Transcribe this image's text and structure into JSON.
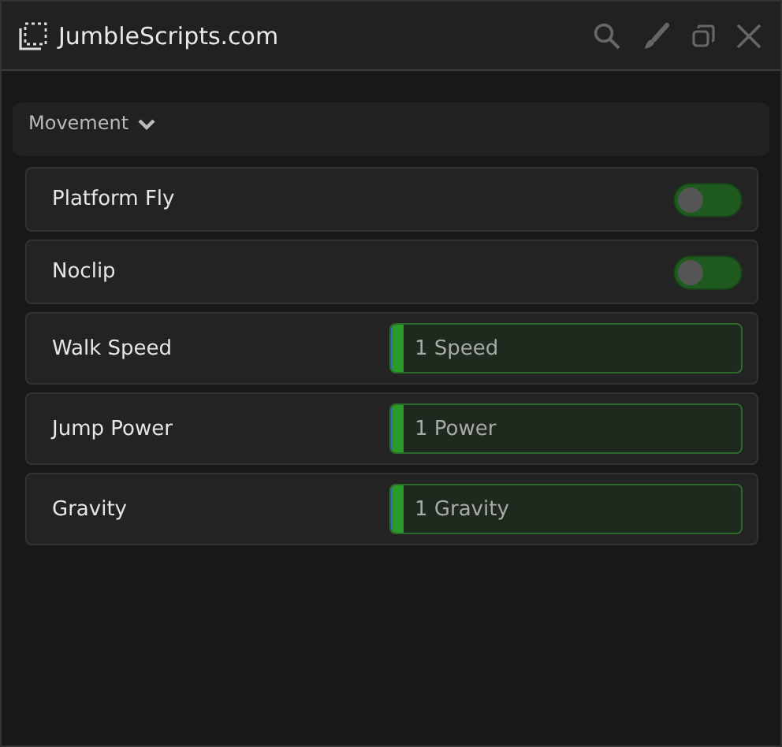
{
  "window": {
    "title": "JumbleScripts.com"
  },
  "section": {
    "title": "Movement",
    "expanded": true
  },
  "items": [
    {
      "kind": "toggle",
      "label": "Platform Fly",
      "on": false
    },
    {
      "kind": "toggle",
      "label": "Noclip",
      "on": false
    },
    {
      "kind": "slider",
      "label": "Walk Speed",
      "value": "1 Speed",
      "level": 0.03
    },
    {
      "kind": "slider",
      "label": "Jump Power",
      "value": "1 Power",
      "level": 0.03
    },
    {
      "kind": "slider",
      "label": "Gravity",
      "value": "1 Gravity",
      "level": 0.03
    }
  ]
}
